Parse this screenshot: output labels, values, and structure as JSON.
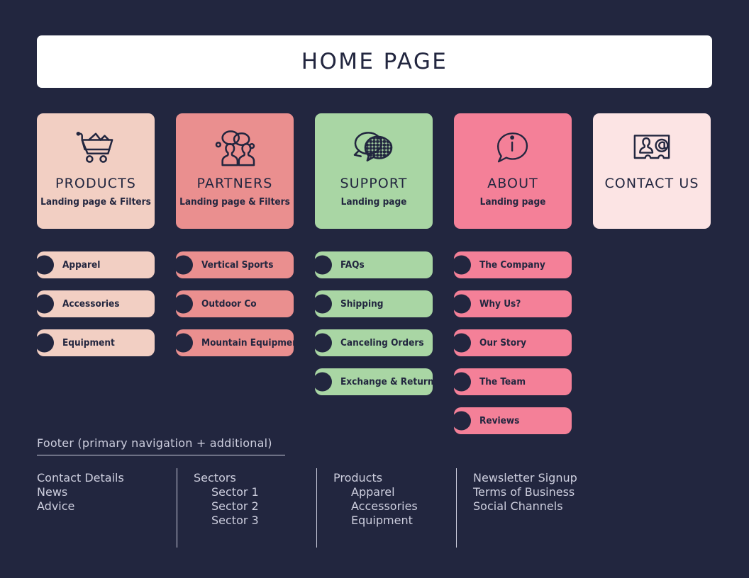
{
  "theme": {
    "background": "#22263f",
    "ink": "#22263f",
    "header_bg": "#ffffff",
    "footer_text": "#cdcede"
  },
  "header": {
    "title": "HOME PAGE"
  },
  "cards": [
    {
      "id": "products",
      "title": "PRODUCTS",
      "subtitle": "Landing page & Filters",
      "color": "#f2cfc3",
      "icon": "shopping-cart-icon"
    },
    {
      "id": "partners",
      "title": "PARTNERS",
      "subtitle": "Landing page & Filters",
      "color": "#ea8f8f",
      "icon": "people-group-icon"
    },
    {
      "id": "support",
      "title": "SUPPORT",
      "subtitle": "Landing page",
      "color": "#a9d6a4",
      "icon": "chat-bubbles-icon"
    },
    {
      "id": "about",
      "title": "ABOUT",
      "subtitle": "Landing page",
      "color": "#f48098",
      "icon": "info-bubble-icon"
    },
    {
      "id": "contact",
      "title": "CONTACT US",
      "subtitle": "",
      "color": "#fce4e4",
      "icon": "contact-card-icon"
    }
  ],
  "columns": [
    {
      "id": "products",
      "color": "#f2cfc3",
      "items": [
        "Apparel",
        "Accessories",
        "Equipment"
      ]
    },
    {
      "id": "partners",
      "color": "#ea8f8f",
      "items": [
        "Vertical Sports",
        "Outdoor Co",
        "Mountain Equipment"
      ]
    },
    {
      "id": "support",
      "color": "#a9d6a4",
      "items": [
        "FAQs",
        "Shipping",
        "Canceling Orders",
        "Exchange & Returns"
      ]
    },
    {
      "id": "about",
      "color": "#f48098",
      "items": [
        "The Company",
        "Why Us?",
        "Our Story",
        "The Team",
        "Reviews"
      ]
    },
    {
      "id": "contact",
      "color": "#fce4e4",
      "items": []
    }
  ],
  "footer": {
    "heading": "Footer (primary navigation + additional)",
    "columns": [
      {
        "links": [
          {
            "label": "Contact Details",
            "indent": false
          },
          {
            "label": "News",
            "indent": false
          },
          {
            "label": "Advice",
            "indent": false
          }
        ]
      },
      {
        "links": [
          {
            "label": "Sectors",
            "indent": false
          },
          {
            "label": "Sector 1",
            "indent": true
          },
          {
            "label": "Sector 2",
            "indent": true
          },
          {
            "label": "Sector 3",
            "indent": true
          }
        ]
      },
      {
        "links": [
          {
            "label": "Products",
            "indent": false
          },
          {
            "label": "Apparel",
            "indent": true
          },
          {
            "label": "Accessories",
            "indent": true
          },
          {
            "label": "Equipment",
            "indent": true
          }
        ]
      },
      {
        "links": [
          {
            "label": "Newsletter Signup",
            "indent": false
          },
          {
            "label": "Terms of Business",
            "indent": false
          },
          {
            "label": "Social Channels",
            "indent": false
          }
        ]
      }
    ]
  }
}
